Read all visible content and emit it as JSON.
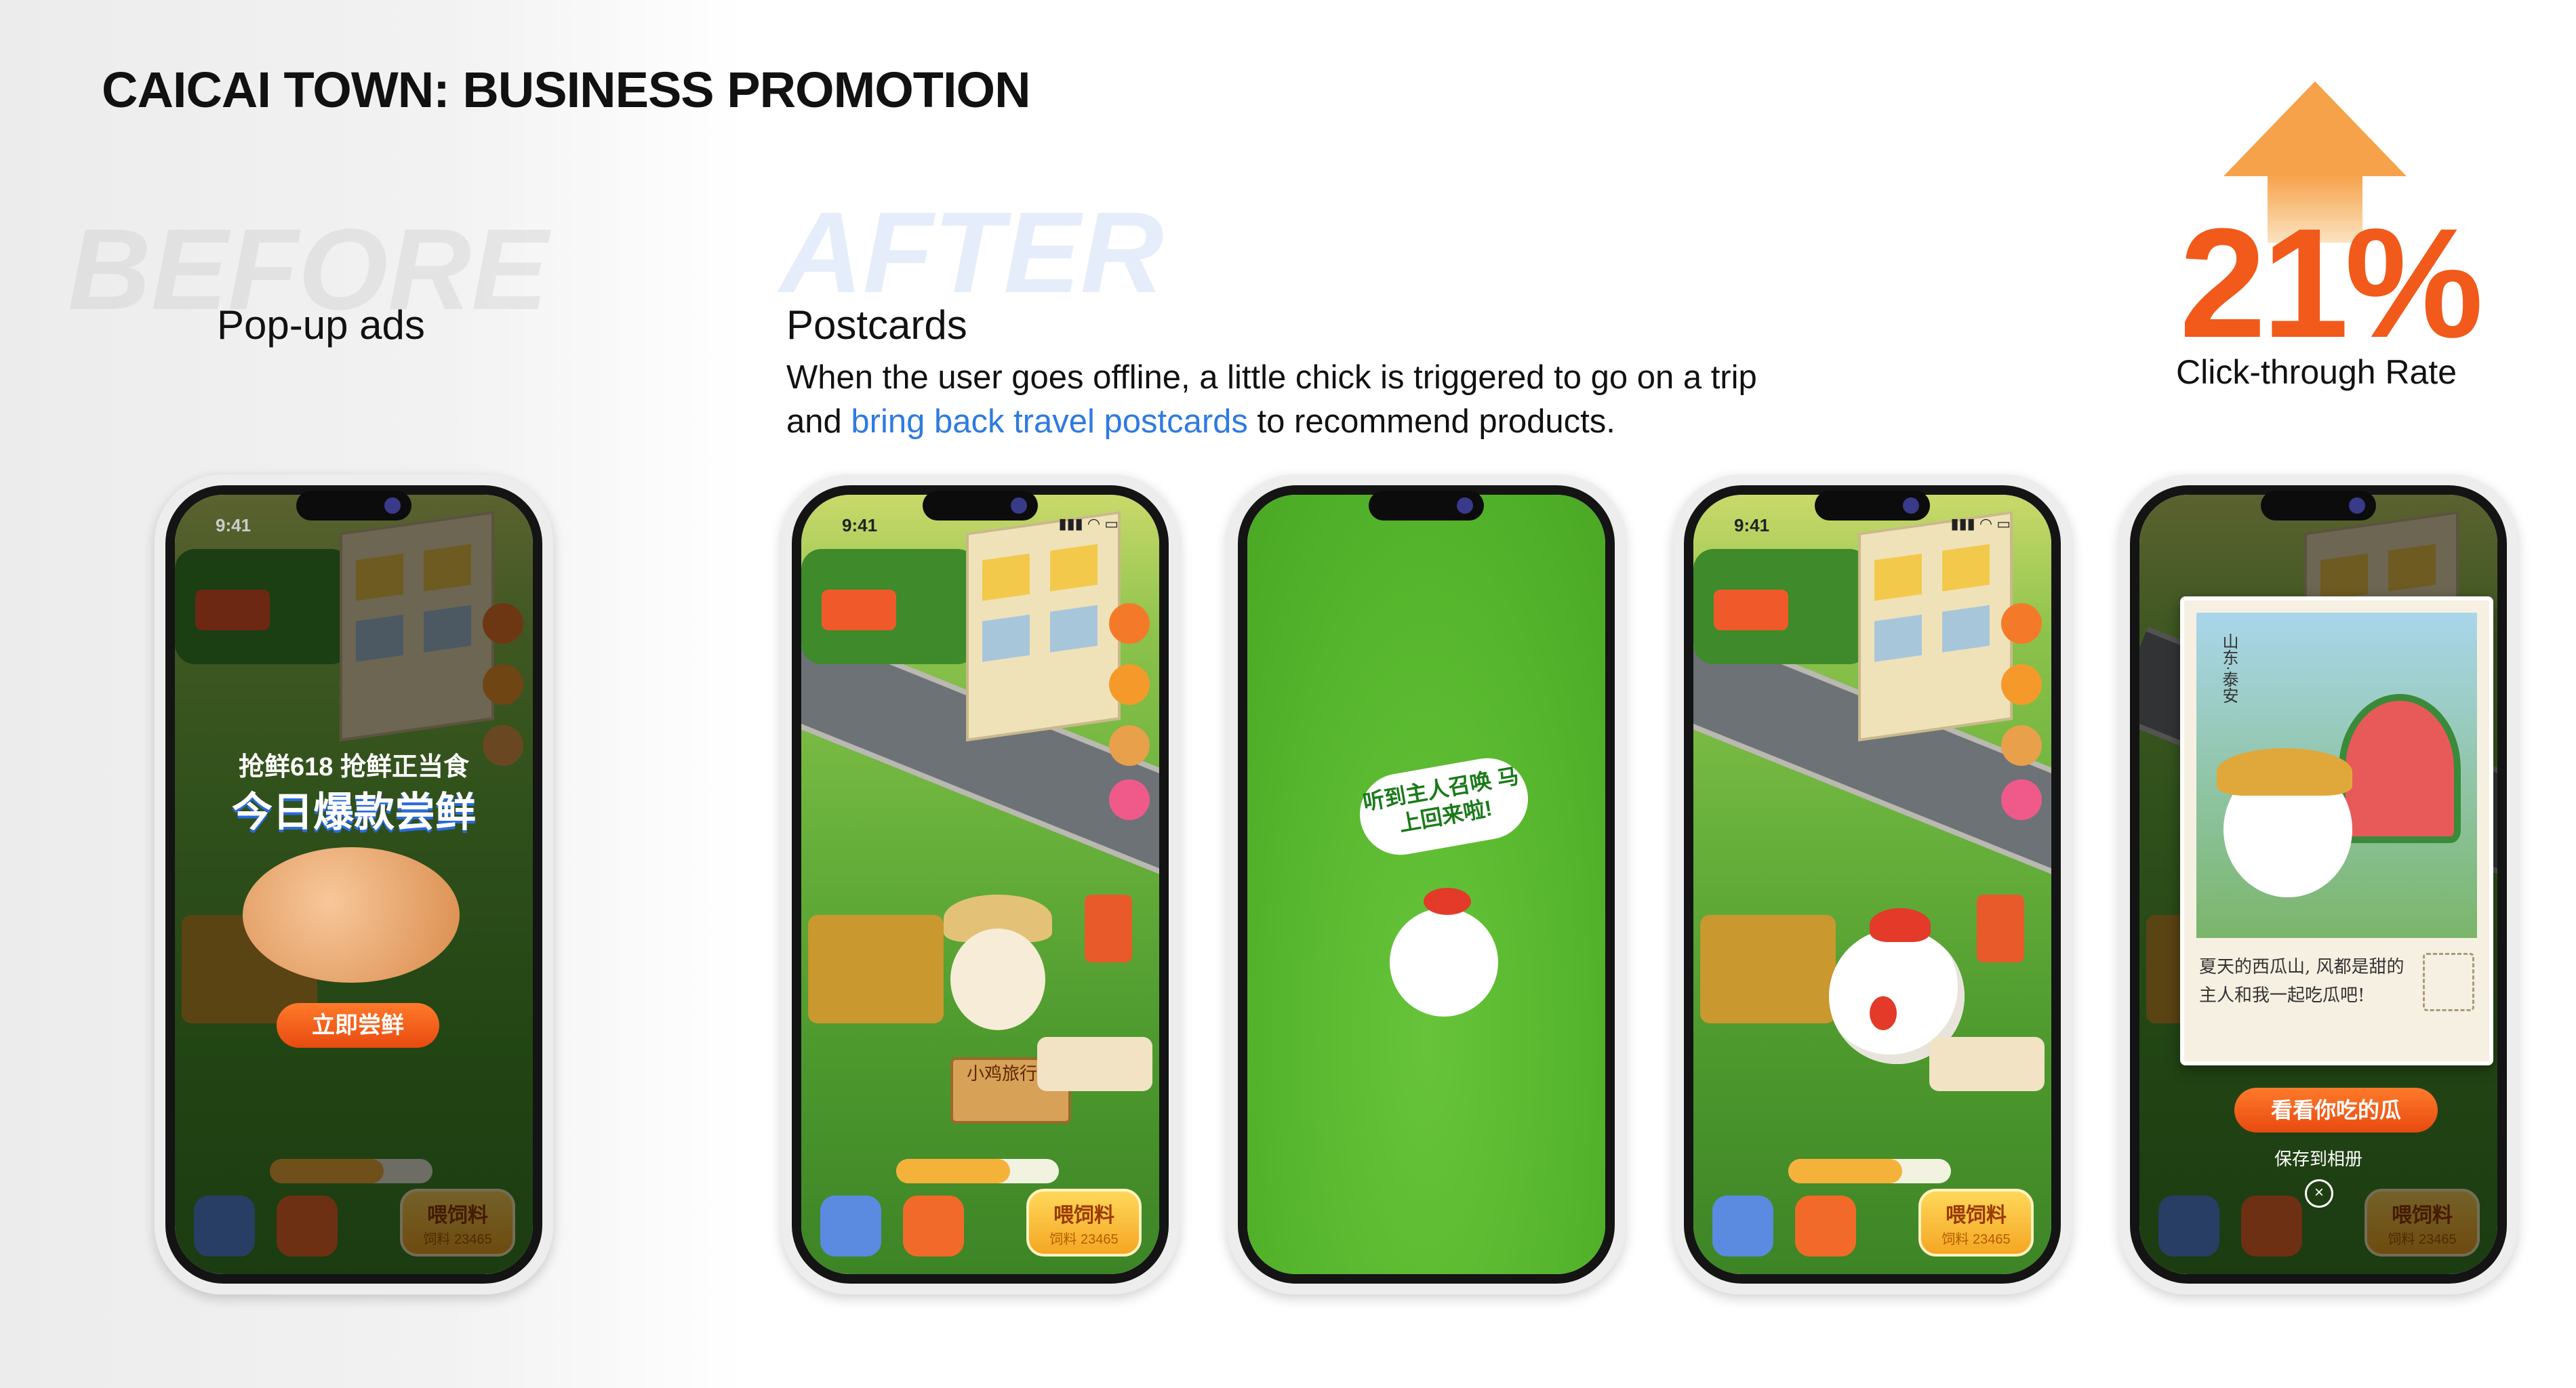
{
  "title": "CAICAI TOWN: BUSINESS PROMOTION",
  "before": {
    "ghost": "BEFORE",
    "label": "Pop-up ads"
  },
  "after": {
    "ghost": "AFTER",
    "label": "Postcards",
    "desc_line1": "When the user goes offline, a little chick is triggered to go on a trip",
    "desc_line2_pre": "and ",
    "desc_highlight": "bring back travel postcards",
    "desc_line2_post": " to recommend products."
  },
  "metric": {
    "value": "21%",
    "label": "Click-through Rate"
  },
  "phone": {
    "time": "9:41",
    "signal": "▮▮▮ ◠ ▭",
    "feed_label": "喂饲料",
    "feed_sub": "饲料 23465"
  },
  "popup_ad": {
    "line1": "抢鲜618 抢鲜正当食",
    "line2": "今日爆款尝鲜",
    "cta": "立即尝鲜"
  },
  "scarecrow_sign": "小鸡旅行中",
  "loading_bubble": "听到主人召唤 马上回来啦!",
  "postcard": {
    "place": "山东·泰安",
    "message": "夏天的西瓜山, 风都是甜的 主人和我一起吃瓜吧!",
    "cta": "看看你吃的瓜",
    "save": "保存到相册",
    "close": "×"
  },
  "colors": {
    "accent": "#f15a1a",
    "highlight": "#2f7ae0",
    "arrow": "#f6a24a"
  }
}
